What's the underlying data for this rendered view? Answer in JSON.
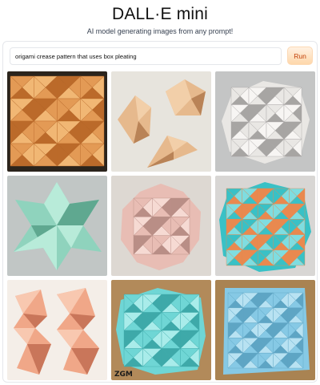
{
  "header": {
    "title": "DALL·E mini",
    "subtitle": "AI model generating images from any prompt!"
  },
  "prompt": {
    "value": "origami crease pattern that uses box pleating"
  },
  "run_button": {
    "label": "Run"
  },
  "results": [
    {
      "subject": "orange box-pleated origami tessellation",
      "colors": [
        "#2b241c",
        "#e39a55",
        "#f1b774",
        "#bb6a2a"
      ]
    },
    {
      "subject": "three small tan origami folded shapes",
      "colors": [
        "#e7e4dd",
        "#e6b98d",
        "#f2cfa9",
        "#b98357"
      ]
    },
    {
      "subject": "white triangular origami tessellation",
      "colors": [
        "#c4c5c5",
        "#e9e7e4",
        "#f7f5f3",
        "#a7a5a3"
      ]
    },
    {
      "subject": "mint green star-shaped origami",
      "colors": [
        "#c1c6c5",
        "#8fd3bd",
        "#b8ebd9",
        "#5fa890"
      ]
    },
    {
      "subject": "pale pink origami tessellation",
      "colors": [
        "#ddd8d2",
        "#e8bdb4",
        "#f6dad3",
        "#b98e86"
      ]
    },
    {
      "subject": "turquoise and orange origami tessellation",
      "colors": [
        "#d8d6d4",
        "#39c1c6",
        "#7fdde0",
        "#e9894f"
      ]
    },
    {
      "subject": "two salmon pink folded origami strips",
      "colors": [
        "#f4eee8",
        "#f0a788",
        "#f8c8b0",
        "#c9765a"
      ]
    },
    {
      "subject": "light cyan origami tessellation on wood",
      "colors": [
        "#b28a5a",
        "#6fd6d5",
        "#a9ecea",
        "#3ea9a9"
      ],
      "watermark": "ZGM"
    },
    {
      "subject": "pale blue origami box pleat grid",
      "colors": [
        "#a98352",
        "#86c9e5",
        "#b8e2f2",
        "#5ea5c4"
      ]
    }
  ]
}
